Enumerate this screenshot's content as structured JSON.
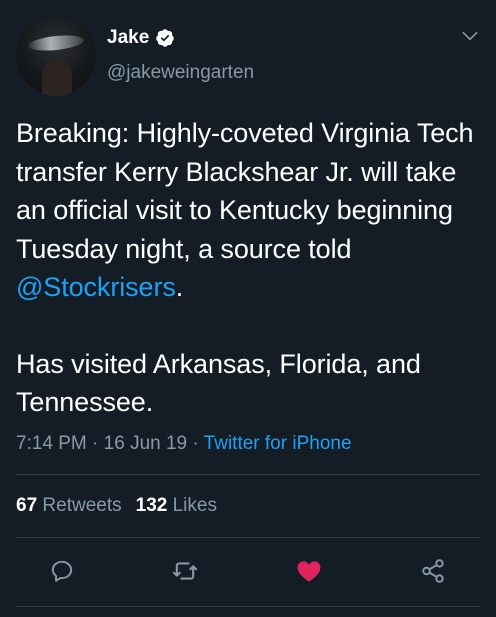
{
  "user": {
    "name": "Jake",
    "handle": "@jakeweingarten"
  },
  "tweet": {
    "text_1_before": "Breaking: Highly-coveted Virginia Tech transfer Kerry Blackshear Jr. will take an official visit to Kentucky beginning Tuesday night, a source told ",
    "mention": "@Stockrisers",
    "text_1_after": ".",
    "text_2": "Has visited Arkansas, Florida, and Tennessee.",
    "time": "7:14 PM",
    "date": "16 Jun 19",
    "separator": " · ",
    "source": "Twitter for iPhone"
  },
  "stats": {
    "retweets_count": "67",
    "retweets_label": "Retweets",
    "likes_count": "132",
    "likes_label": "Likes"
  },
  "icons": {
    "reply": "reply-icon",
    "retweet": "retweet-icon",
    "like": "heart-icon",
    "share": "share-icon",
    "menu": "chevron-down-icon",
    "verified": "verified-badge-icon"
  },
  "colors": {
    "background": "#141d26",
    "accent": "#1da1f2",
    "muted": "#8899a6",
    "like": "#e0245e"
  }
}
